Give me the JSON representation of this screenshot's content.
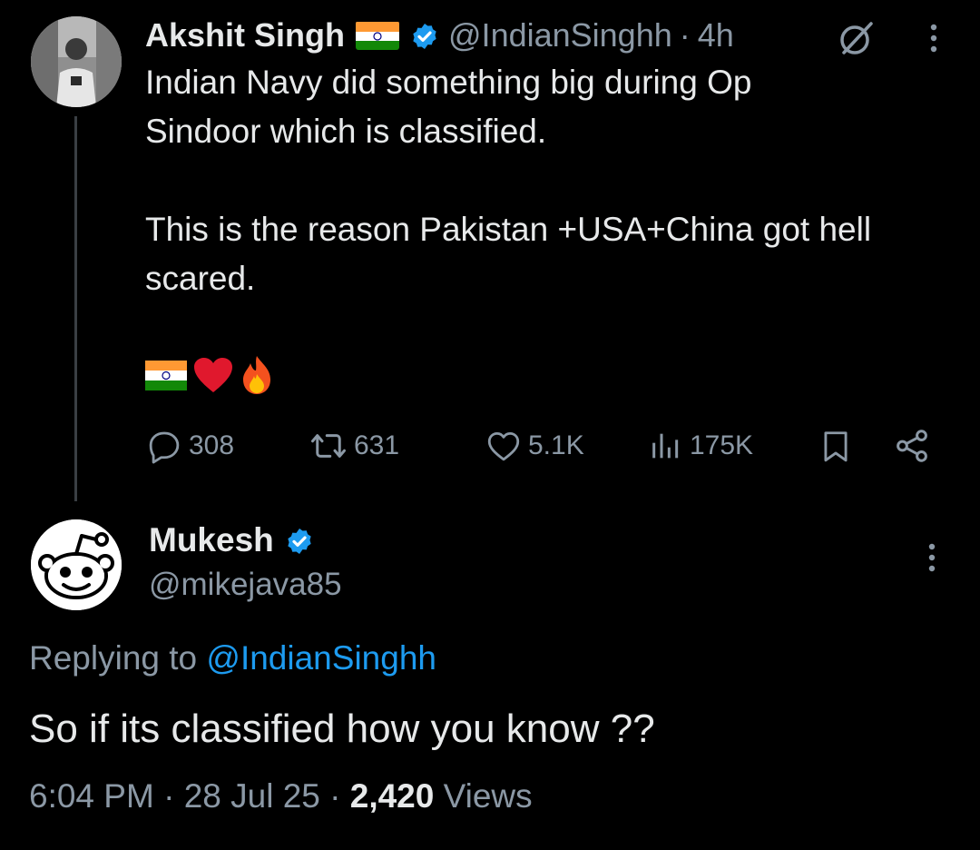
{
  "parent_tweet": {
    "display_name": "Akshit Singh",
    "handle": "@IndianSinghh",
    "separator": "·",
    "time_ago": "4h",
    "text_lines": [
      "Indian Navy did something big  during Op",
      "Sindoor which is classified.",
      "",
      "This is the reason Pakistan +USA+China got hell",
      "scared."
    ],
    "emojis": [
      "flag-india",
      "red-heart",
      "fire"
    ],
    "actions": {
      "replies": "308",
      "reposts": "631",
      "likes": "5.1K",
      "views": "175K"
    }
  },
  "reply_tweet": {
    "display_name": "Mukesh",
    "handle": "@mikejava85",
    "replying_prefix": "Replying to",
    "replying_to": "@IndianSinghh",
    "text": "So if its classified how you know ??",
    "time": "6:04 PM",
    "date": "28 Jul 25",
    "separator": "·",
    "views_count": "2,420",
    "views_label": "Views"
  },
  "colors": {
    "background": "#000000",
    "primary_text": "#e7e9ea",
    "secondary_text": "#8b98a5",
    "link": "#1d9bf0",
    "verified": "#1d9bf0",
    "thread_line": "#3a3f44"
  },
  "icons": [
    "verified-badge-icon",
    "grok-icon",
    "more-icon",
    "reply-icon",
    "repost-icon",
    "like-icon",
    "views-icon",
    "bookmark-icon",
    "share-icon",
    "reddit-style-avatar"
  ]
}
